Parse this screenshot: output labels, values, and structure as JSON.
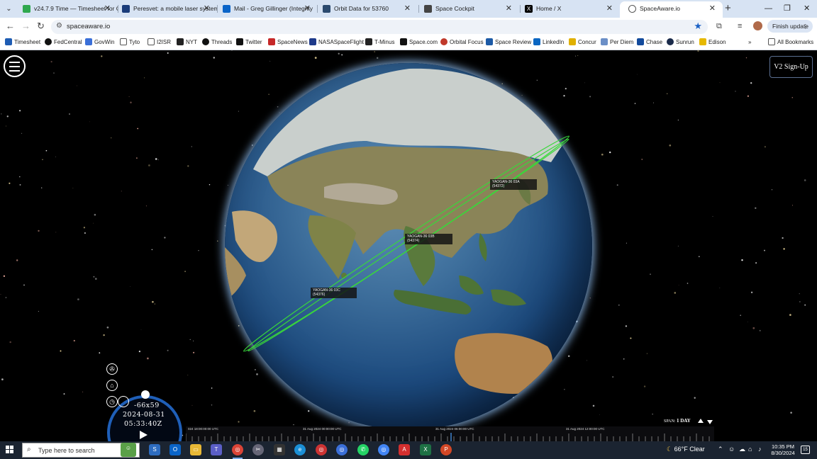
{
  "browser": {
    "tabs": [
      {
        "title": "v24.7.9 Time — Timesheet for G",
        "color": "#2fa84f"
      },
      {
        "title": "Peresvet: a mobile laser system",
        "color": "#1a3c7a"
      },
      {
        "title": "Mail - Greg Gillinger (Integrity",
        "color": "#0a64c8"
      },
      {
        "title": "Orbit Data for 53760",
        "color": "#2b4a6e"
      },
      {
        "title": "Space Cockpit",
        "color": "#444"
      },
      {
        "title": "Home / X",
        "color": "#000"
      },
      {
        "title": "SpaceAware.io",
        "color": "#555"
      }
    ],
    "active_tab_index": 6,
    "url": "spaceaware.io",
    "finish_update_label": "Finish update",
    "bookmarks": [
      {
        "label": "Timesheet",
        "color": "#1e5cb3"
      },
      {
        "label": "FedCentral",
        "color": "#111"
      },
      {
        "label": "GovWin",
        "color": "#3a6fd8"
      },
      {
        "label": "Tyto",
        "color": "#555"
      },
      {
        "label": "I2ISR",
        "color": "#555"
      },
      {
        "label": "NYT",
        "color": "#222"
      },
      {
        "label": "Threads",
        "color": "#111"
      },
      {
        "label": "Twitter",
        "color": "#111"
      },
      {
        "label": "SpaceNews",
        "color": "#c62828"
      },
      {
        "label": "NASASpaceFlight",
        "color": "#1e3a8a"
      },
      {
        "label": "T-Minus",
        "color": "#222"
      },
      {
        "label": "Space.com",
        "color": "#111"
      },
      {
        "label": "Orbital Focus",
        "color": "#c0392b"
      },
      {
        "label": "Space Review",
        "color": "#1c5aa6"
      },
      {
        "label": "LinkedIn",
        "color": "#0a66c2"
      },
      {
        "label": "Concur",
        "color": "#e0b000"
      },
      {
        "label": "Per Diem",
        "color": "#6b8fc7"
      },
      {
        "label": "Chase",
        "color": "#124a9c"
      },
      {
        "label": "Sunrun",
        "color": "#1a2a4a"
      },
      {
        "label": "Edison",
        "color": "#e6b800"
      }
    ],
    "all_bookmarks_label": "All Bookmarks"
  },
  "app": {
    "signup_label": "V2 Sign-Up",
    "satellites": [
      {
        "name": "YAOGAN-36 03A",
        "id": "(54372)"
      },
      {
        "name": "YAOGAN-36 03B",
        "id": "(54374)"
      },
      {
        "name": "YAOGAN-36 03C",
        "id": "(54376)"
      }
    ],
    "clock": {
      "offset": "-66x59",
      "date": "2024-08-31",
      "time": "05:33:40Z"
    },
    "span": {
      "label": "SPAN:",
      "value": "1 DAY"
    },
    "timeline_labels": [
      "024 18:00:00:00 UTC",
      "31 Aug 2024 00:00:00 UTC",
      "31 Aug 2024 06:00:00 UTC",
      "31 Aug 2024 12:00:00 UTC"
    ],
    "orbit_color": "#39d83a"
  },
  "taskbar": {
    "search_placeholder": "Type here to search",
    "apps": [
      "Teams",
      "S",
      "Outlook",
      "Explorer",
      "Teams",
      "Chrome",
      "Snip",
      "Calculator",
      "Edge",
      "Chrome",
      "Chrome",
      "WhatsApp",
      "Chrome",
      "Acrobat",
      "Excel",
      "PowerPoint"
    ],
    "weather": "66°F  Clear",
    "time": "10:35 PM",
    "date": "8/30/2024",
    "notification_count": "15"
  }
}
